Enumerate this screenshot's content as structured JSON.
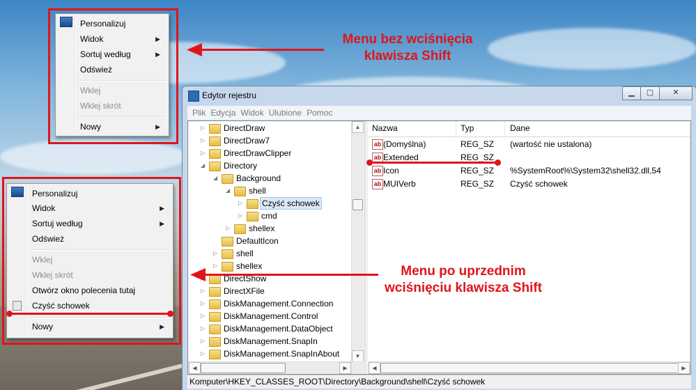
{
  "menu_top": {
    "items": [
      {
        "label": "Personalizuj",
        "disabled": false,
        "submenu": false
      },
      {
        "label": "Widok",
        "disabled": false,
        "submenu": true
      },
      {
        "label": "Sortuj według",
        "disabled": false,
        "submenu": true
      },
      {
        "label": "Odśwież",
        "disabled": false,
        "submenu": false
      },
      {
        "label": "Wklej",
        "disabled": true,
        "submenu": false
      },
      {
        "label": "Wklej skrót",
        "disabled": true,
        "submenu": false
      },
      {
        "label": "Nowy",
        "disabled": false,
        "submenu": true
      }
    ]
  },
  "menu_bottom": {
    "items": [
      {
        "label": "Personalizuj",
        "disabled": false,
        "submenu": false
      },
      {
        "label": "Widok",
        "disabled": false,
        "submenu": true
      },
      {
        "label": "Sortuj według",
        "disabled": false,
        "submenu": true
      },
      {
        "label": "Odśwież",
        "disabled": false,
        "submenu": false
      },
      {
        "label": "Wklej",
        "disabled": true,
        "submenu": false
      },
      {
        "label": "Wklej skrót",
        "disabled": true,
        "submenu": false
      },
      {
        "label": "Otwórz okno polecenia tutaj",
        "disabled": false,
        "submenu": false
      },
      {
        "label": "Czyść schowek",
        "disabled": false,
        "submenu": false
      },
      {
        "label": "Nowy",
        "disabled": false,
        "submenu": true
      }
    ]
  },
  "annotations": {
    "top_line1": "Menu bez wciśnięcia",
    "top_line2": "klawisza Shift",
    "bottom_line1": "Menu po uprzednim",
    "bottom_line2": "wciśnięciu klawisza Shift"
  },
  "window": {
    "title": "Edytor rejestru",
    "menus": [
      "Plik",
      "Edycja",
      "Widok",
      "Ulubione",
      "Pomoc"
    ],
    "tree": [
      {
        "label": "DirectDraw",
        "depth": 0,
        "twisty": "closed"
      },
      {
        "label": "DirectDraw7",
        "depth": 0,
        "twisty": "closed"
      },
      {
        "label": "DirectDrawClipper",
        "depth": 0,
        "twisty": "closed"
      },
      {
        "label": "Directory",
        "depth": 0,
        "twisty": "open"
      },
      {
        "label": "Background",
        "depth": 1,
        "twisty": "open"
      },
      {
        "label": "shell",
        "depth": 2,
        "twisty": "open"
      },
      {
        "label": "Czyść schowek",
        "depth": 3,
        "twisty": "closed",
        "selected": true
      },
      {
        "label": "cmd",
        "depth": 3,
        "twisty": "closed"
      },
      {
        "label": "shellex",
        "depth": 2,
        "twisty": "closed"
      },
      {
        "label": "DefaultIcon",
        "depth": 1,
        "twisty": "none"
      },
      {
        "label": "shell",
        "depth": 1,
        "twisty": "closed"
      },
      {
        "label": "shellex",
        "depth": 1,
        "twisty": "closed"
      },
      {
        "label": "DirectShow",
        "depth": 0,
        "twisty": "closed"
      },
      {
        "label": "DirectXFile",
        "depth": 0,
        "twisty": "closed"
      },
      {
        "label": "DiskManagement.Connection",
        "depth": 0,
        "twisty": "closed"
      },
      {
        "label": "DiskManagement.Control",
        "depth": 0,
        "twisty": "closed"
      },
      {
        "label": "DiskManagement.DataObject",
        "depth": 0,
        "twisty": "closed"
      },
      {
        "label": "DiskManagement.SnapIn",
        "depth": 0,
        "twisty": "closed"
      },
      {
        "label": "DiskManagement.SnapInAbout",
        "depth": 0,
        "twisty": "closed"
      }
    ],
    "columns": [
      "Nazwa",
      "Typ",
      "Dane"
    ],
    "values": [
      {
        "name": "(Domyślna)",
        "type": "REG_SZ",
        "data": "(wartość nie ustalona)"
      },
      {
        "name": "Extended",
        "type": "REG_SZ",
        "data": ""
      },
      {
        "name": "Icon",
        "type": "REG_SZ",
        "data": "%SystemRoot%\\System32\\shell32.dll,54"
      },
      {
        "name": "MUIVerb",
        "type": "REG_SZ",
        "data": "Czyść schowek"
      }
    ],
    "status": "Komputer\\HKEY_CLASSES_ROOT\\Directory\\Background\\shell\\Czyść schowek"
  },
  "colors": {
    "accent": "#e0141a"
  }
}
